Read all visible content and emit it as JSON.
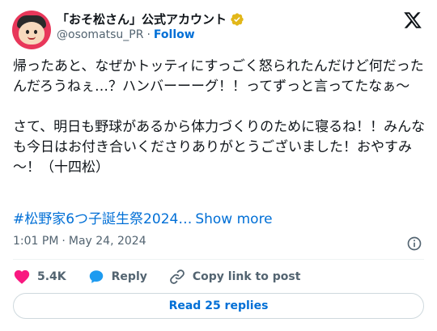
{
  "author": {
    "display_name": "「おそ松さん」公式アカウント",
    "handle": "@osomatsu_PR",
    "separator": "·",
    "follow_label": "Follow"
  },
  "tweet": {
    "text": "帰ったあと、なぜかトッティにすっごく怒られたんだけど何だったんだろうねぇ…？ハンバーーーグ！！ってずっと言ってたなぁ～\n\nさて、明日も野球があるから体力づくりのために寝るね！！みんなも今日はお付き合いくださりありがとうございました！おやすみ～！（十四松）",
    "hashtag": "#松野家6つ子誕生祭2024…",
    "show_more_label": "Show more"
  },
  "meta": {
    "time": "1:01 PM",
    "separator": "·",
    "date": "May 24, 2024"
  },
  "actions": {
    "like_count": "5.4K",
    "reply_label": "Reply",
    "copy_link_label": "Copy link to post"
  },
  "read_replies_label": "Read 25 replies",
  "colors": {
    "link": "#006fd6",
    "like": "#f91880",
    "verified": "#e2b719",
    "text": "#0f1419",
    "secondary": "#536471"
  },
  "icons": [
    "verified-badge-icon",
    "x-logo-icon",
    "info-icon",
    "heart-icon",
    "reply-bubble-icon",
    "link-icon"
  ]
}
